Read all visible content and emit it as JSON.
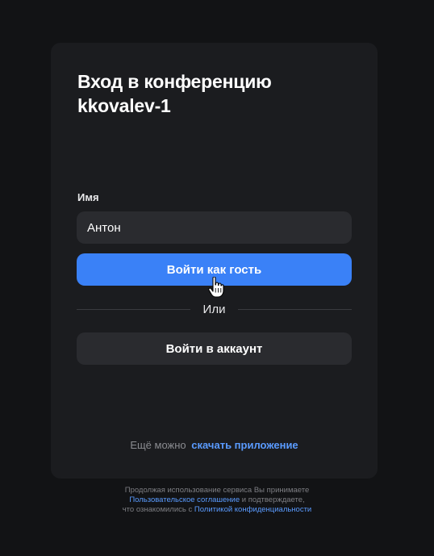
{
  "login": {
    "title_line1": "Вход в конференцию",
    "title_line2": "kkovalev-1",
    "name_label": "Имя",
    "name_value": "Антон",
    "guest_button": "Войти как гость",
    "divider_text": "Или",
    "account_button": "Войти в аккаунт",
    "download_prefix": "Ещё можно",
    "download_link": "скачать приложение"
  },
  "legal": {
    "line1": "Продолжая использование сервиса Вы принимаете",
    "agreement_link": "Пользовательское соглашение",
    "line2_suffix": " и подтверждаете,",
    "line3_prefix": "что ознакомились с ",
    "privacy_link": "Политикой конфиденциальности"
  },
  "colors": {
    "background": "#121315",
    "card": "#1b1c1f",
    "primary": "#3a81f7",
    "link": "#5a9bff"
  },
  "icons": {
    "cursor": "hand-pointer-cursor"
  }
}
